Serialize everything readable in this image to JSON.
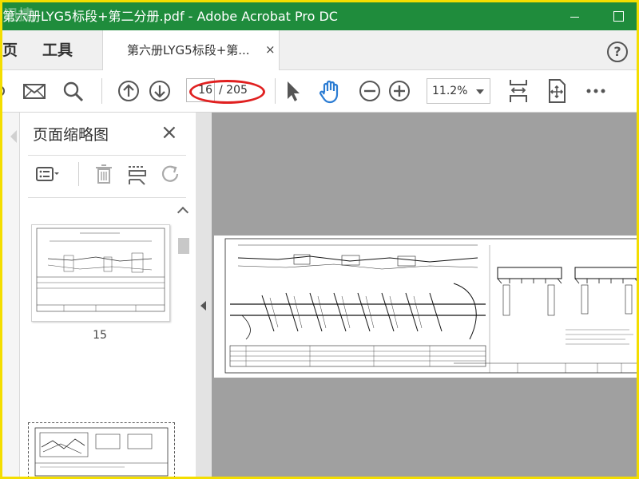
{
  "window": {
    "title": "第六册LYG5标段+第二分册.pdf - Adobe Acrobat Pro DC",
    "watermark": "迅捷"
  },
  "menu": {
    "home": "页",
    "tools": "工具"
  },
  "tab": {
    "label": "第六册LYG5标段+第...",
    "close": "×"
  },
  "help": "?",
  "toolbar": {
    "current_page": "16",
    "total_pages": "/ 205",
    "zoom": "11.2%"
  },
  "thumbnail_panel": {
    "title": "页面缩略图",
    "close": "×",
    "thumbnails": [
      {
        "number": "15"
      }
    ]
  },
  "icons": {
    "toolbar": [
      "mail-icon",
      "search-icon",
      "prev-page-icon",
      "next-page-icon",
      "select-arrow-icon",
      "hand-tool-icon",
      "zoom-out-icon",
      "zoom-in-icon",
      "fit-width-icon",
      "fit-page-icon",
      "more-icon"
    ],
    "panel": [
      "thumbnail-options-icon",
      "delete-icon",
      "insert-icon",
      "rotate-icon"
    ]
  },
  "colors": {
    "titlebar": "#1f8c3c",
    "border": "#f4de00",
    "annotation": "#e02020",
    "hand_tool": "#2b7cd3"
  }
}
